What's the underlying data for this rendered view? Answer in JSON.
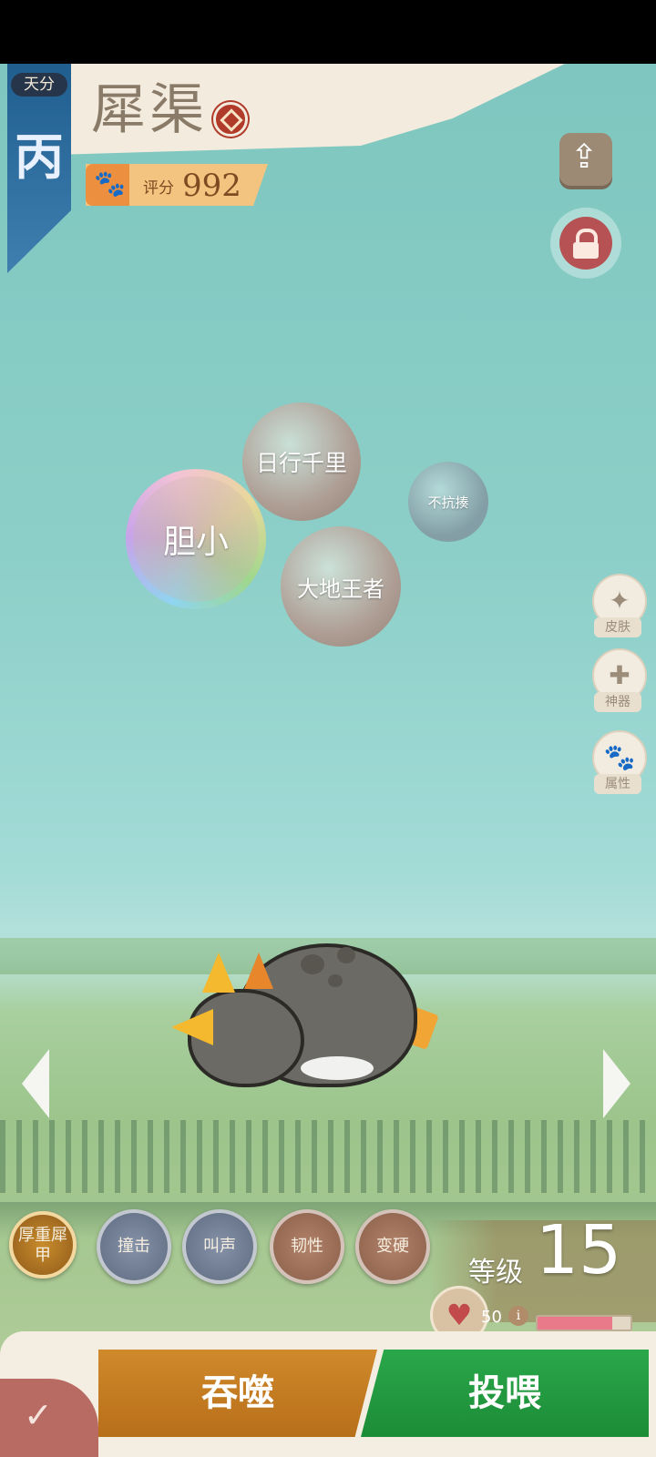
{
  "header": {
    "rank_label": "天分",
    "rank_value": "丙",
    "pet_name": "犀渠",
    "score_label": "评分",
    "score_value": "992"
  },
  "bubbles": [
    "日行千里",
    "胆小",
    "不抗揍",
    "大地王者"
  ],
  "side_menu": [
    {
      "label": "皮肤",
      "icon": "butterfly-icon"
    },
    {
      "label": "神器",
      "icon": "plus-circle-icon"
    },
    {
      "label": "属性",
      "icon": "paw-icon"
    }
  ],
  "skills": [
    "厚重犀甲",
    "撞击",
    "叫声",
    "韧性",
    "变硬"
  ],
  "level": {
    "label": "等级",
    "value": "15"
  },
  "food": {
    "count": "50",
    "hunger_fraction": 0.8
  },
  "actions": {
    "devour": "吞噬",
    "feed": "投喂"
  },
  "colors": {
    "devour": "#c47c22",
    "feed": "#22983f",
    "rank_tag": "#2f6e9f"
  }
}
